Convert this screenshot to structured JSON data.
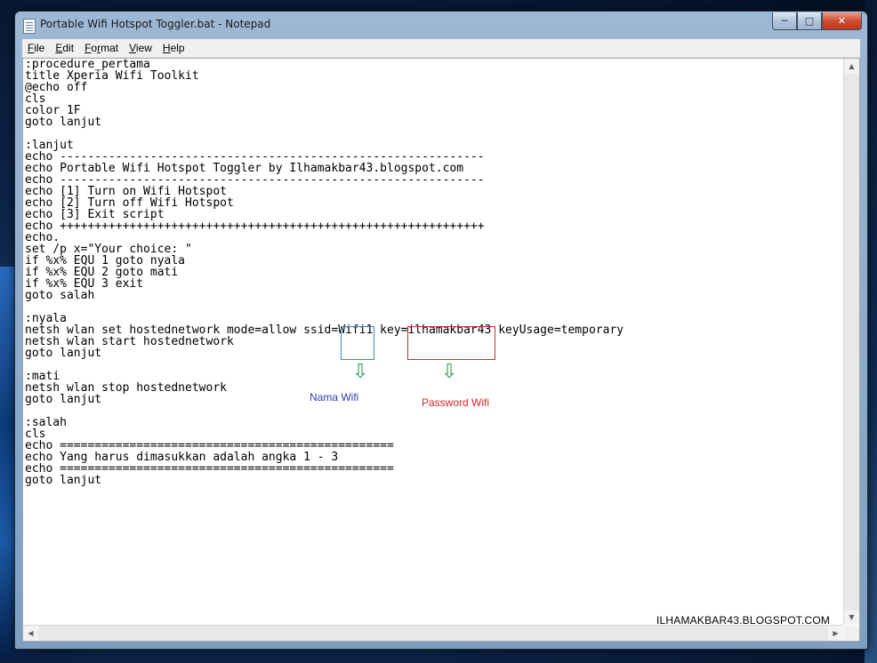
{
  "window": {
    "title": "Portable Wifi Hotspot Toggler.bat - Notepad",
    "buttons": {
      "minimize": "─",
      "maximize": "□",
      "close": "✕"
    }
  },
  "menu": [
    {
      "accel": "F",
      "rest": "ile"
    },
    {
      "accel": "E",
      "rest": "dit"
    },
    {
      "accel": "",
      "rest": "F"
    },
    {
      "accel": "V",
      "rest": "iew"
    },
    {
      "accel": "H",
      "rest": "elp"
    }
  ],
  "menu_labels": [
    "File",
    "Edit",
    "Format",
    "View",
    "Help"
  ],
  "code": ":procedure_pertama\ntitle Xperia Wifi Toolkit\n@echo off\ncls\ncolor 1F\ngoto lanjut\n\n:lanjut\necho -------------------------------------------------------------\necho Portable Wifi Hotspot Toggler by Ilhamakbar43.blogspot.com\necho -------------------------------------------------------------\necho [1] Turn on Wifi Hotspot\necho [2] Turn off Wifi Hotspot\necho [3] Exit script\necho +++++++++++++++++++++++++++++++++++++++++++++++++++++++++++++\necho.\nset /p x=\"Your choice: \"\nif %x% EQU 1 goto nyala\nif %x% EQU 2 goto mati\nif %x% EQU 3 exit\ngoto salah\n\n:nyala\nnetsh wlan set hostednetwork mode=allow ssid=Wifi1 key=ilhamakbar43 keyUsage=temporary\nnetsh wlan start hostednetwork\ngoto lanjut\n\n:mati\nnetsh wlan stop hostednetwork\ngoto lanjut\n\n:salah\ncls\necho ================================================\necho Yang harus dimasukkan adalah angka 1 - 3\necho ================================================\ngoto lanjut",
  "annotations": {
    "ssid_label": "Nama Wifi",
    "key_label": "Password Wifi",
    "arrow": "⇩",
    "ssid_color": "#2a3fb0",
    "key_color": "#d42424"
  },
  "watermark": "ILHAMAKBAR43.BLOGSPOT.COM",
  "scroll_arrows": {
    "up": "▲",
    "down": "▼",
    "left": "◀",
    "right": "▶"
  }
}
